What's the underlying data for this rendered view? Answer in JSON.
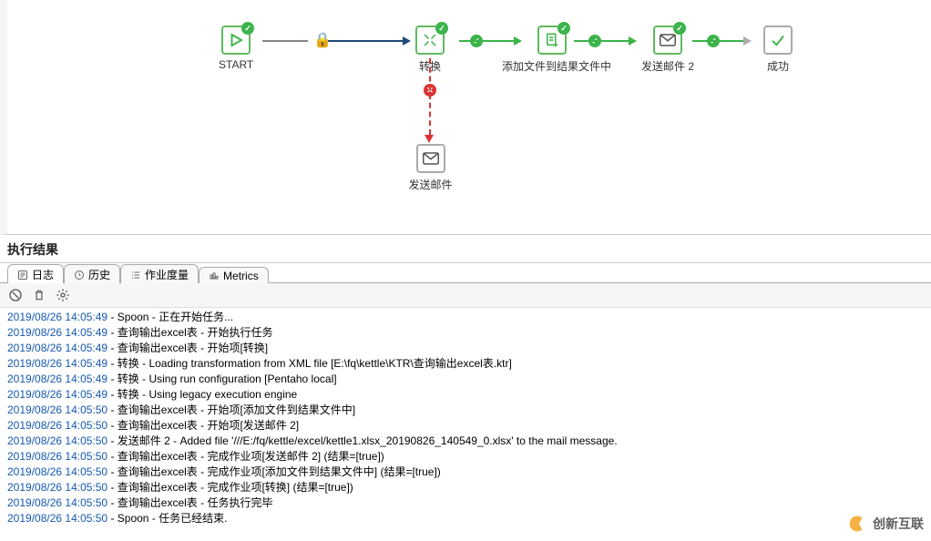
{
  "diagram": {
    "nodes": {
      "start": {
        "label": "START"
      },
      "transform": {
        "label": "转换"
      },
      "addfile": {
        "label": "添加文件到结果文件中"
      },
      "mail2": {
        "label": "发送邮件 2"
      },
      "success": {
        "label": "成功"
      },
      "mail": {
        "label": "发送邮件"
      }
    }
  },
  "results": {
    "title": "执行结果",
    "tabs": {
      "log": "日志",
      "history": "历史",
      "metrics_cn": "作业度量",
      "metrics": "Metrics"
    },
    "log": [
      {
        "ts": "2019/08/26 14:05:49",
        "msg": "Spoon - 正在开始任务..."
      },
      {
        "ts": "2019/08/26 14:05:49",
        "msg": "查询输出excel表 - 开始执行任务"
      },
      {
        "ts": "2019/08/26 14:05:49",
        "msg": "查询输出excel表 - 开始项[转换]"
      },
      {
        "ts": "2019/08/26 14:05:49",
        "msg": "转换 - Loading transformation from XML file [E:\\fq\\kettle\\KTR\\查询输出excel表.ktr]"
      },
      {
        "ts": "2019/08/26 14:05:49",
        "msg": "转换 - Using run configuration [Pentaho local]"
      },
      {
        "ts": "2019/08/26 14:05:49",
        "msg": "转换 - Using legacy execution engine"
      },
      {
        "ts": "2019/08/26 14:05:50",
        "msg": "查询输出excel表 - 开始项[添加文件到结果文件中]"
      },
      {
        "ts": "2019/08/26 14:05:50",
        "msg": "查询输出excel表 - 开始项[发送邮件 2]"
      },
      {
        "ts": "2019/08/26 14:05:50",
        "msg": "发送邮件 2 - Added file '///E:/fq/kettle/excel/kettle1.xlsx_20190826_140549_0.xlsx' to the mail message."
      },
      {
        "ts": "2019/08/26 14:05:50",
        "msg": "查询输出excel表 - 完成作业项[发送邮件 2] (结果=[true])"
      },
      {
        "ts": "2019/08/26 14:05:50",
        "msg": "查询输出excel表 - 完成作业项[添加文件到结果文件中] (结果=[true])"
      },
      {
        "ts": "2019/08/26 14:05:50",
        "msg": "查询输出excel表 - 完成作业项[转换] (结果=[true])"
      },
      {
        "ts": "2019/08/26 14:05:50",
        "msg": "查询输出excel表 - 任务执行完毕"
      },
      {
        "ts": "2019/08/26 14:05:50",
        "msg": "Spoon - 任务已经结束."
      }
    ]
  },
  "watermark": {
    "text": "创新互联"
  }
}
